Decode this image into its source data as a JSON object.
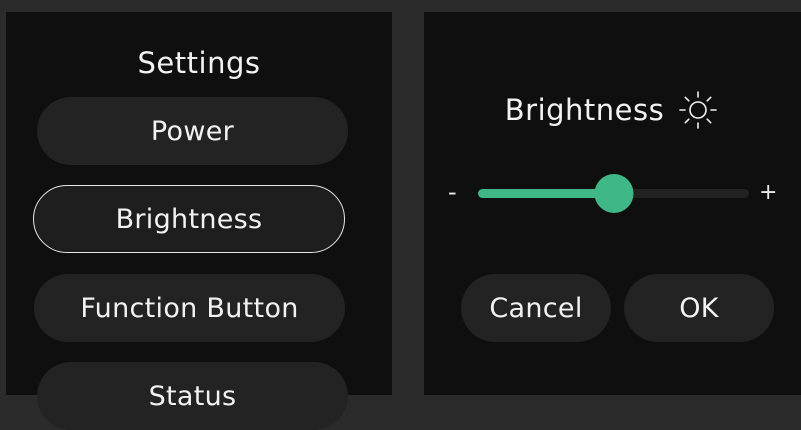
{
  "settings": {
    "title": "Settings",
    "items": [
      {
        "label": "Power",
        "selected": false
      },
      {
        "label": "Brightness",
        "selected": true
      },
      {
        "label": "Function Button",
        "selected": false
      },
      {
        "label": "Status",
        "selected": false
      }
    ]
  },
  "brightness": {
    "title": "Brightness",
    "icon": "sun-icon",
    "slider": {
      "min_label": "-",
      "max_label": "+",
      "value": 0.5
    },
    "cancel_label": "Cancel",
    "ok_label": "OK"
  },
  "colors": {
    "accent": "#3fb786",
    "panel": "#0f0f0f",
    "button": "#232323",
    "background": "#2b2b2b"
  }
}
